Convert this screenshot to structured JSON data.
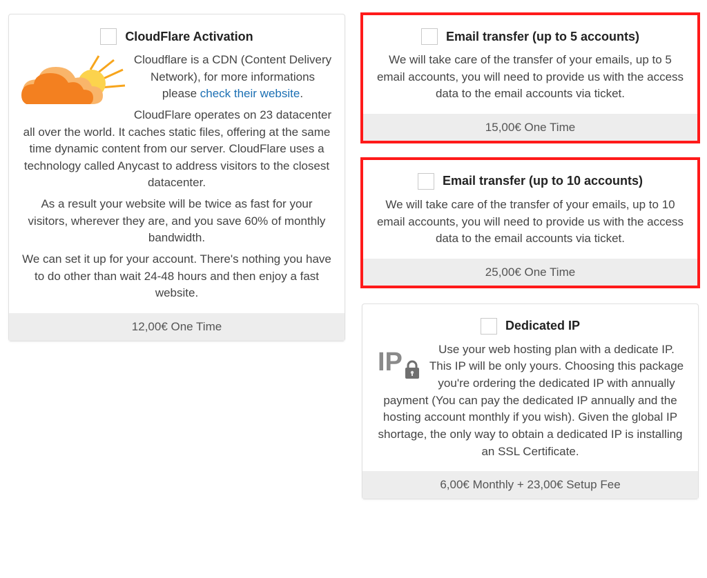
{
  "left": {
    "cloudflare": {
      "title": "CloudFlare Activation",
      "desc_intro_a": "Cloudflare is a CDN (Content Delivery Network), for more informations please ",
      "desc_intro_link": "check their website",
      "desc_intro_b": ".",
      "desc_p2": "CloudFlare operates on 23 datacenter all over the world. It caches static files, offering at the same time dynamic content from our server. CloudFlare uses a technology called Anycast to address visitors to the closest datacenter.",
      "desc_p3": "As a result your website will be twice as fast for your visitors, wherever they are, and you save 60% of monthly bandwidth.",
      "desc_p4": "We can set it up for your account. There's nothing you have to do other than wait 24-48 hours and then enjoy a fast website.",
      "price": "12,00€ One Time"
    }
  },
  "right": {
    "email5": {
      "title": "Email transfer (up to 5 accounts)",
      "desc": "We will take care of the transfer of your emails, up to 5 email accounts, you will need to provide us with the access data to the email accounts via ticket.",
      "price": "15,00€ One Time"
    },
    "email10": {
      "title": "Email transfer (up to 10 accounts)",
      "desc": "We will take care of the transfer of your emails, up to 10 email accounts, you will need to provide us with the access data to the email accounts via ticket.",
      "price": "25,00€ One Time"
    },
    "dedicated_ip": {
      "title": "Dedicated IP",
      "desc": "Use your web hosting plan with a dedicate IP. This IP will be only yours. Choosing this package you're ordering the dedicated IP with annually payment (You can pay the dedicated IP annually and the hosting account monthly if you wish). Given the global IP shortage, the only way to obtain a dedicated IP is installing an SSL Certificate.",
      "price": "6,00€ Monthly + 23,00€ Setup Fee"
    }
  }
}
